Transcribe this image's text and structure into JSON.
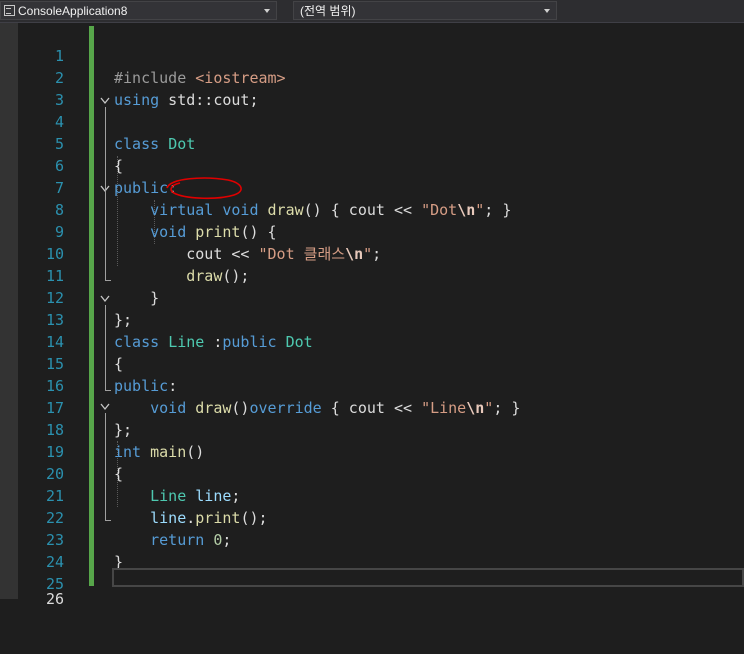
{
  "navbar": {
    "project": "ConsoleApplication8",
    "scope": "(전역 범위)"
  },
  "editor": {
    "current_line": 26,
    "lines": [
      {
        "n": "1",
        "code": "#include <iostream>"
      },
      {
        "n": "2",
        "code": "using std::cout;"
      },
      {
        "n": "3",
        "code": ""
      },
      {
        "n": "4",
        "code": "class Dot"
      },
      {
        "n": "5",
        "code": "{"
      },
      {
        "n": "6",
        "code": "public:"
      },
      {
        "n": "7",
        "code": "    virtual void draw() { cout << \"Dot\\n\"; }"
      },
      {
        "n": "8",
        "code": "    void print() {"
      },
      {
        "n": "9",
        "code": "        cout << \"Dot 클래스\\n\";"
      },
      {
        "n": "10",
        "code": "        draw();"
      },
      {
        "n": "11",
        "code": "    }"
      },
      {
        "n": "12",
        "code": "};"
      },
      {
        "n": "13",
        "code": "class Line :public Dot"
      },
      {
        "n": "14",
        "code": "{"
      },
      {
        "n": "15",
        "code": "public:"
      },
      {
        "n": "16",
        "code": "    void draw()override { cout << \"Line\\n\"; }"
      },
      {
        "n": "17",
        "code": "};"
      },
      {
        "n": "18",
        "code": "int main()"
      },
      {
        "n": "19",
        "code": "{"
      },
      {
        "n": "20",
        "code": "    Line line;"
      },
      {
        "n": "21",
        "code": "    line.print();"
      },
      {
        "n": "22",
        "code": "    return 0;"
      },
      {
        "n": "23",
        "code": "}"
      },
      {
        "n": "24",
        "code": ""
      },
      {
        "n": "25",
        "code": ""
      },
      {
        "n": "26",
        "code": ""
      }
    ]
  },
  "colors": {
    "background": "#1e1e1e",
    "keyword": "#569cd6",
    "type": "#4ec9b0",
    "string": "#d69d85",
    "change_bar": "#57a64a",
    "annotation": "#e00000"
  }
}
